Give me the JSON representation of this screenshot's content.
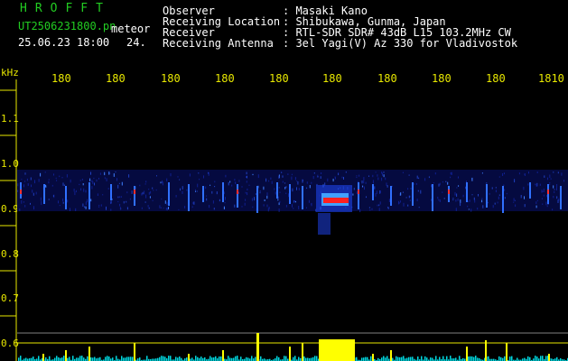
{
  "header": {
    "title": "HROFFT",
    "filename": "UT2506231800.pn",
    "mode": "meteor",
    "datetime": "25.06.23 18:00",
    "count": "24.",
    "fields": [
      {
        "label": "Observer",
        "value": ": Masaki Kano"
      },
      {
        "label": "Receiving Location",
        "value": ": Shibukawa, Gunma, Japan"
      },
      {
        "label": "Receiver",
        "value": ": RTL-SDR SDR# 43dB L15 103.2MHz CW"
      },
      {
        "label": "Receiving Antenna",
        "value": ": 3el Yagi(V) Az 330 for Vladivostok"
      }
    ]
  },
  "time_axis": {
    "ticks": [
      "180",
      "180",
      "180",
      "180",
      "180",
      "180",
      "180",
      "180",
      "180",
      "1810"
    ]
  },
  "freq_axis": {
    "unit": "kHz",
    "ticks": [
      "1.1",
      "1.0",
      "0.9",
      "0.8",
      "0.7",
      "0.6"
    ]
  },
  "colors": {
    "background": "#000000",
    "text_header": "#ffffff",
    "title": "#22cc22",
    "axis": "#e8e800",
    "echo_core": "#ff2020",
    "echo_mid": "#40a0ff",
    "noise": "#1020a0",
    "baseline": "#00e0e0",
    "meteor_bar": "#ffff00"
  }
}
